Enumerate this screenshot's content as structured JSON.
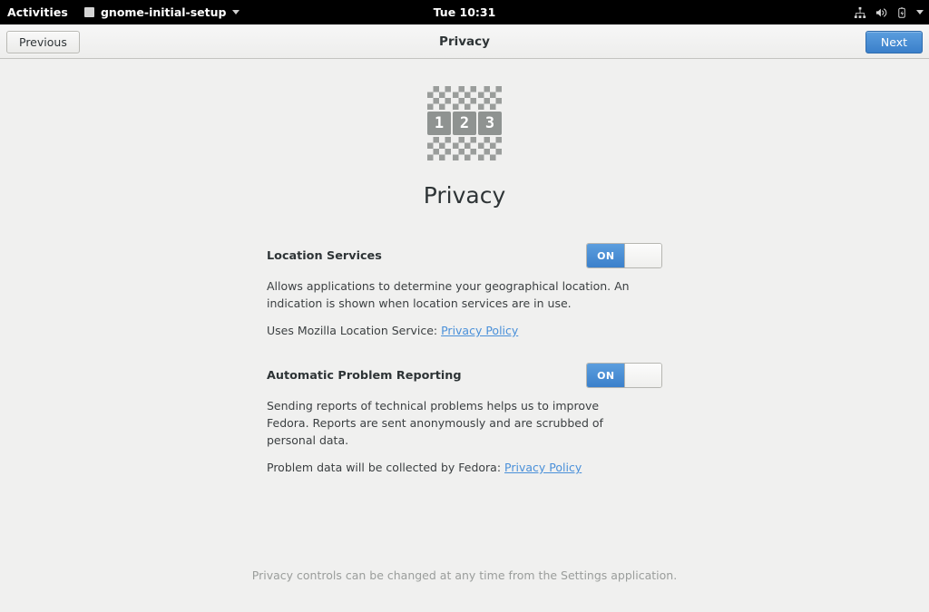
{
  "topbar": {
    "activities": "Activities",
    "app_name": "gnome-initial-setup",
    "clock": "Tue 10:31",
    "icons": {
      "app": "window-icon",
      "menu_caret": "chevron-down-icon",
      "network": "network-wired-icon",
      "volume": "volume-high-icon",
      "battery": "battery-charging-icon",
      "system_caret": "chevron-down-icon"
    }
  },
  "headerbar": {
    "title": "Privacy",
    "previous_label": "Previous",
    "next_label": "Next",
    "next_color": "#3a7fca"
  },
  "hero": {
    "icon_name": "privacy-123-icon",
    "icon_digits": [
      "1",
      "2",
      "3"
    ],
    "title": "Privacy"
  },
  "settings": [
    {
      "label": "Location Services",
      "toggle_state": "ON",
      "toggle_on": true,
      "description": "Allows applications to determine your geographical location. An indication is shown when location services are in use.",
      "link_prefix": "Uses Mozilla Location Service: ",
      "link_label": "Privacy Policy"
    },
    {
      "label": "Automatic Problem Reporting",
      "toggle_state": "ON",
      "toggle_on": true,
      "description": "Sending reports of technical problems helps us to improve Fedora. Reports are sent anonymously and are scrubbed of personal data.",
      "link_prefix": "Problem data will be collected by Fedora: ",
      "link_label": "Privacy Policy"
    }
  ],
  "footnote": "Privacy controls can be changed at any time from the Settings application."
}
